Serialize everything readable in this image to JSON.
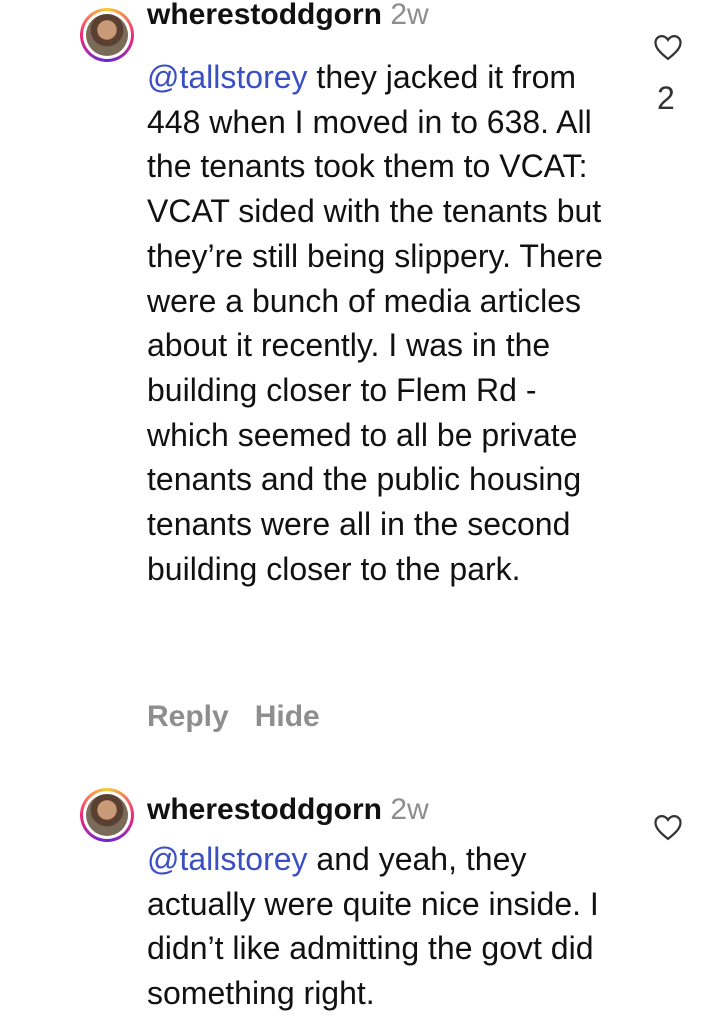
{
  "comments": [
    {
      "username": "wherestoddgorn",
      "time": "2w",
      "mention": "@tallstorey",
      "text": " they jacked it from 448 when I moved in to 638. All the tenants took them to VCAT: VCAT sided with the tenants but they’re still being slippery. There were a bunch of media articles about it recently. I was in the building closer to Flem Rd - which seemed to all be private tenants and the public housing tenants were all in the second building closer to the park.",
      "likes": "2",
      "reply_label": "Reply",
      "hide_label": "Hide"
    },
    {
      "username": "wherestoddgorn",
      "time": "2w",
      "mention": "@tallstorey",
      "text": " and yeah, they actually were quite nice inside. I didn’t like admitting the govt did something right."
    }
  ],
  "icons": {
    "like": "heart-icon"
  },
  "colors": {
    "mention": "#3b4fc4",
    "muted": "#8e8e8e"
  }
}
